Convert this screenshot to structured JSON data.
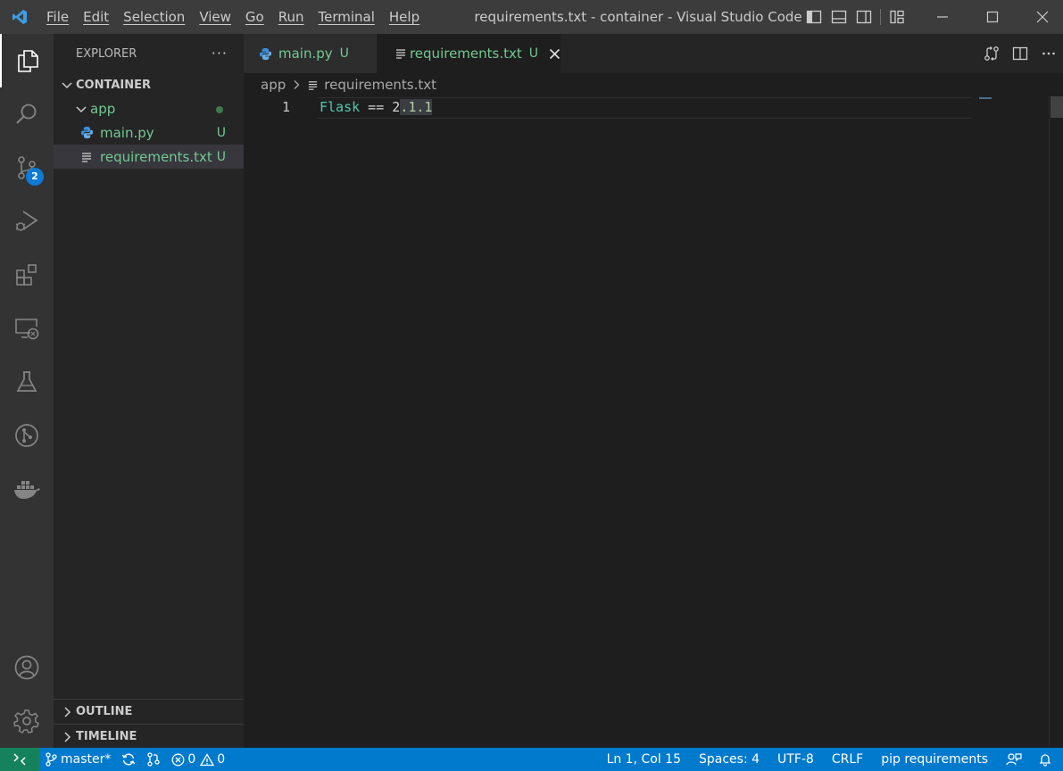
{
  "titlebar": {
    "menu": [
      "File",
      "Edit",
      "Selection",
      "View",
      "Go",
      "Run",
      "Terminal",
      "Help"
    ],
    "window_title": "requirements.txt - container - Visual Studio Code"
  },
  "activity_bar": {
    "source_control_badge": "2"
  },
  "sidebar": {
    "title": "EXPLORER",
    "more": "···",
    "root": "CONTAINER",
    "tree": [
      {
        "label": "app",
        "type": "folder",
        "status": ""
      },
      {
        "label": "main.py",
        "type": "python",
        "status": "U"
      },
      {
        "label": "requirements.txt",
        "type": "text",
        "status": "U"
      }
    ],
    "outline": "OUTLINE",
    "timeline": "TIMELINE"
  },
  "tabs": [
    {
      "label": "main.py",
      "status": "U",
      "active": false
    },
    {
      "label": "requirements.txt",
      "status": "U",
      "active": true
    }
  ],
  "breadcrumb": [
    "app",
    "requirements.txt"
  ],
  "editor": {
    "lines": [
      {
        "number": "1",
        "package": "Flask",
        "operator": " == ",
        "version_first": "2",
        "version_rest": ".1.1"
      }
    ]
  },
  "statusbar": {
    "branch": "master*",
    "errors": "0",
    "warnings": "0",
    "position": "Ln 1, Col 15",
    "indent": "Spaces: 4",
    "encoding": "UTF-8",
    "eol": "CRLF",
    "language": "pip requirements"
  },
  "colors": {
    "accent": "#007acc",
    "remote": "#16825d",
    "untracked": "#73c991",
    "vscode_blue": "#3b9ee6"
  }
}
